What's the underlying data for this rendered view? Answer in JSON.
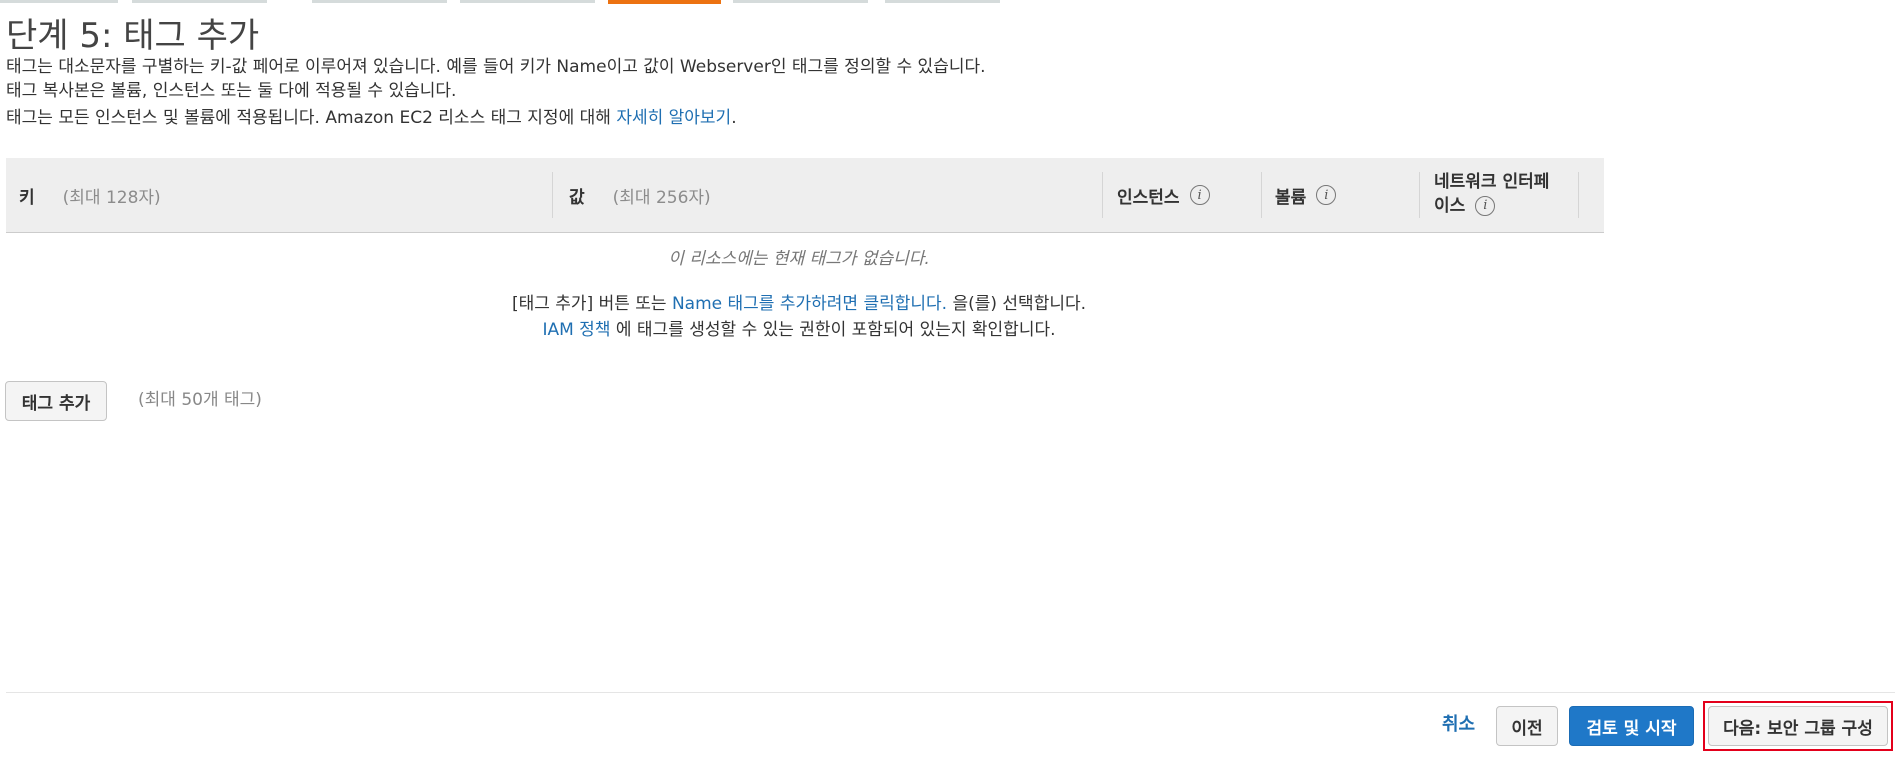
{
  "page": {
    "title": "단계 5: 태그 추가",
    "desc_line1": "태그는 대소문자를 구별하는 키-값 페어로 이루어져 있습니다. 예를 들어 키가 Name이고 값이 Webserver인 태그를 정의할 수 있습니다.",
    "desc_line2": "태그 복사본은 볼륨, 인스턴스 또는 둘 다에 적용될 수 있습니다.",
    "desc_line3_prefix": "태그는 모든 인스턴스 및 볼륨에 적용됩니다. Amazon EC2 리소스 태그 지정에 대해 ",
    "learn_more_link": "자세히 알아보기",
    "desc_line3_suffix": "."
  },
  "table": {
    "key_header": "키",
    "key_hint": "(최대 128자)",
    "value_header": "값",
    "value_hint": "(최대 256자)",
    "instances_header": "인스턴스",
    "volumes_header": "볼륨",
    "network_header_line1": "네트워크 인터페",
    "network_header_line2": "이스",
    "info_icon_glyph": "i"
  },
  "empty_state": {
    "no_tags": "이 리소스에는 현재 태그가 없습니다.",
    "line2_prefix": "[태그 추가] 버튼 또는 ",
    "line2_link": "Name 태그를 추가하려면 클릭합니다.",
    "line2_suffix": " 을(를) 선택합니다.",
    "line3_link": "IAM 정책",
    "line3_suffix": " 에 태그를 생성할 수 있는 권한이 포함되어 있는지 확인합니다."
  },
  "actions": {
    "add_tag": "태그 추가",
    "limit_note": "(최대 50개 태그)"
  },
  "footer": {
    "cancel": "취소",
    "previous": "이전",
    "review_launch": "검토 및 시작",
    "next": "다음: 보안 그룹 구성"
  },
  "colors": {
    "link": "#1f6fb2",
    "primary_button": "#1f78c8",
    "active_step": "#ec7211",
    "highlight": "#e3001b"
  }
}
